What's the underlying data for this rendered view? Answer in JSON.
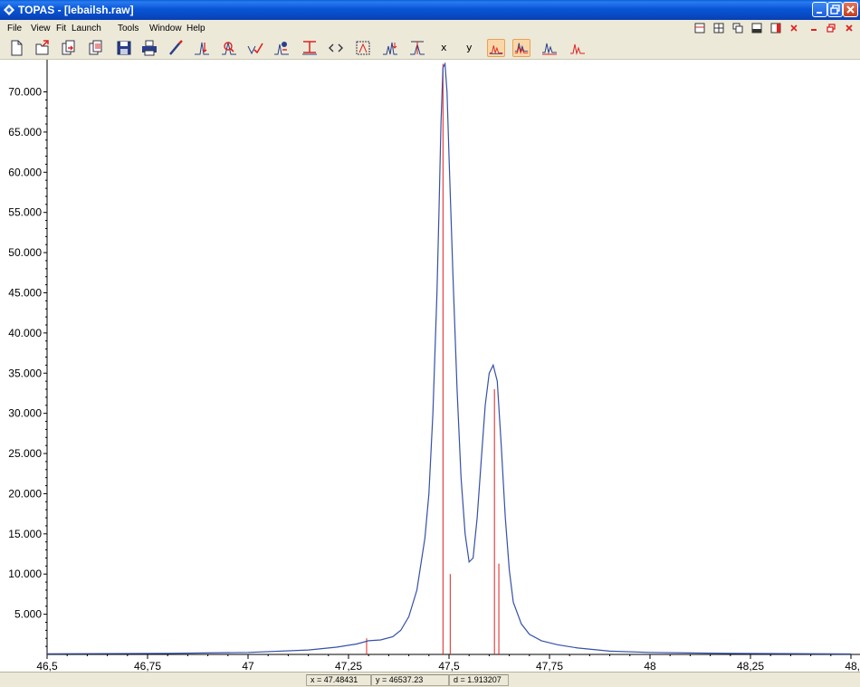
{
  "window": {
    "title": "TOPAS - [lebailsh.raw]"
  },
  "menu": [
    "File",
    "View",
    "Fit",
    "Launch",
    "Tools",
    "Window",
    "Help"
  ],
  "toolbar": {
    "tools": [
      {
        "name": "new-file-icon",
        "kind": "doc"
      },
      {
        "name": "open-file-icon",
        "kind": "open"
      },
      {
        "name": "import-icon",
        "kind": "import"
      },
      {
        "name": "export-icon",
        "kind": "export"
      },
      {
        "name": "save-icon",
        "kind": "save"
      },
      {
        "name": "print-icon",
        "kind": "print"
      },
      {
        "name": "wand-icon",
        "kind": "wand"
      },
      {
        "name": "peak-search-icon",
        "kind": "peak"
      },
      {
        "name": "peak-zoom-icon",
        "kind": "peakzoom"
      },
      {
        "name": "peak-check-icon",
        "kind": "check"
      },
      {
        "name": "fit-run-icon",
        "kind": "run"
      },
      {
        "name": "background-icon",
        "kind": "bg"
      },
      {
        "name": "code-icon",
        "kind": "code"
      },
      {
        "name": "zoom-fit-icon",
        "kind": "zoomfit"
      },
      {
        "name": "peak-down-icon",
        "kind": "peakdown"
      },
      {
        "name": "peak-edit-icon",
        "kind": "peakedit"
      }
    ],
    "x_label": "x",
    "y_label": "y",
    "pattern_tools": [
      {
        "name": "pattern-view-1-icon",
        "active": true
      },
      {
        "name": "pattern-view-2-icon",
        "active": true
      },
      {
        "name": "pattern-view-3-icon",
        "active": false
      },
      {
        "name": "pattern-view-4-icon",
        "active": false
      },
      {
        "name": "pattern-view-5-icon",
        "active": false
      }
    ]
  },
  "chart_data": {
    "type": "line",
    "xlim": [
      46.5,
      48.5
    ],
    "ylim": [
      0,
      74000
    ],
    "x_ticks": [
      46.5,
      46.75,
      47,
      47.25,
      47.5,
      47.75,
      48,
      48.25,
      48.5
    ],
    "x_tick_labels": [
      "46,5",
      "46,75",
      "47",
      "47,25",
      "47,5",
      "47,75",
      "48",
      "48,25",
      "48,"
    ],
    "y_ticks": [
      5000,
      10000,
      15000,
      20000,
      25000,
      30000,
      35000,
      40000,
      45000,
      50000,
      55000,
      60000,
      65000,
      70000
    ],
    "y_tick_labels": [
      "5.000",
      "10.000",
      "15.000",
      "20.000",
      "25.000",
      "30.000",
      "35.000",
      "40.000",
      "45.000",
      "50.000",
      "55.000",
      "60.000",
      "65.000",
      "70.000"
    ],
    "series": [
      {
        "color": "#3550a8",
        "x": [
          46.5,
          46.8,
          47.0,
          47.15,
          47.22,
          47.27,
          47.3,
          47.33,
          47.36,
          47.38,
          47.4,
          47.42,
          47.44,
          47.45,
          47.46,
          47.47,
          47.475,
          47.48,
          47.485,
          47.49,
          47.495,
          47.5,
          47.51,
          47.52,
          47.53,
          47.54,
          47.55,
          47.56,
          47.57,
          47.58,
          47.59,
          47.6,
          47.61,
          47.62,
          47.63,
          47.64,
          47.65,
          47.66,
          47.68,
          47.7,
          47.73,
          47.77,
          47.82,
          47.9,
          48.0,
          48.2,
          48.5
        ],
        "y": [
          80,
          120,
          250,
          550,
          900,
          1300,
          1700,
          1800,
          2200,
          3000,
          4700,
          8000,
          14500,
          20000,
          30000,
          45000,
          55000,
          66000,
          73000,
          73500,
          70000,
          62000,
          47000,
          33000,
          22000,
          15000,
          11500,
          12000,
          17000,
          24000,
          31000,
          35000,
          36000,
          34000,
          26000,
          17000,
          10500,
          6500,
          3800,
          2500,
          1700,
          1200,
          800,
          400,
          250,
          120,
          60
        ]
      }
    ],
    "reflection_markers": [
      {
        "x": 47.295,
        "height": 2000
      },
      {
        "x": 47.485,
        "height": 73500
      },
      {
        "x": 47.503,
        "height": 10000
      },
      {
        "x": 47.613,
        "height": 33000
      },
      {
        "x": 47.624,
        "height": 11300
      }
    ],
    "marker_color": "#e02020"
  },
  "status": {
    "x": "x = 47.48431",
    "y": "y = 46537.23",
    "d": "d = 1.913207"
  }
}
